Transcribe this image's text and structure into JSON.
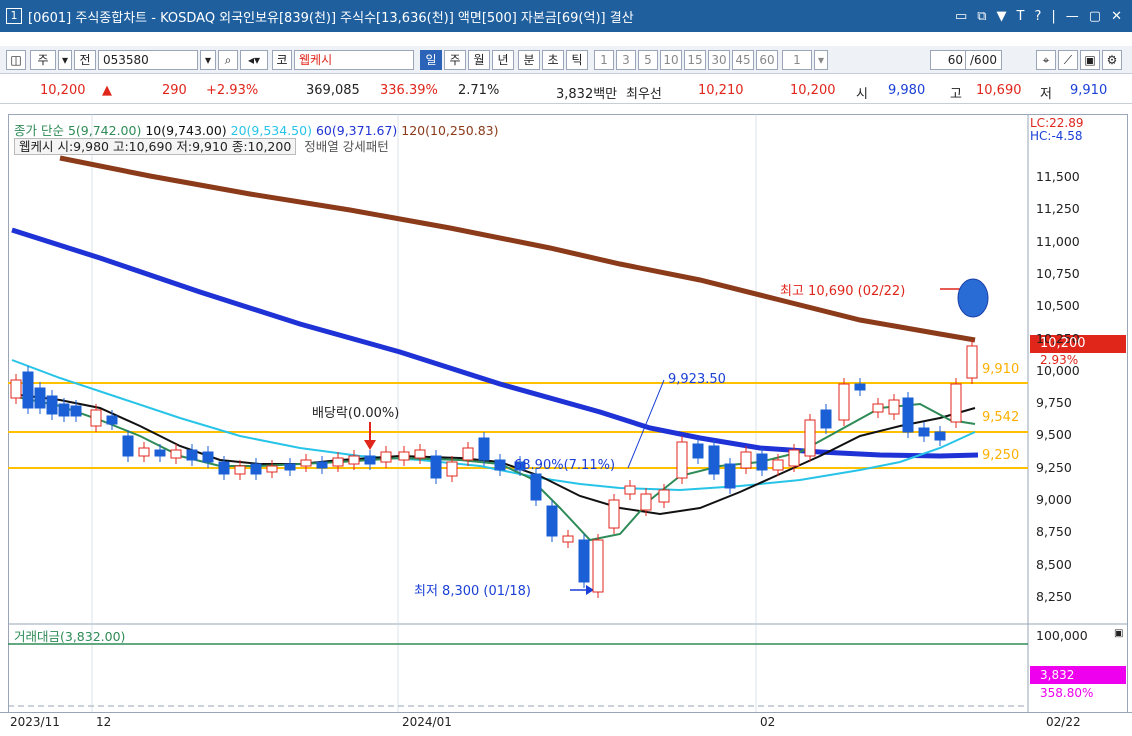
{
  "titlebar": {
    "num": "1",
    "title": "[0601] 주식종합차트 - KOSDAQ 외국인보유[839(천)] 주식수[13,636(천)] 액면[500] 자본금[69(억)] 결산",
    "buttons": [
      "▭",
      "⧉",
      "▼",
      "T",
      "?",
      "|",
      "—",
      "▢",
      "✕"
    ]
  },
  "toolbar": {
    "type_select": "주",
    "range_select": "전",
    "code": "053580",
    "market": "코",
    "name": "웹케시",
    "periods": [
      "일",
      "주",
      "월",
      "년",
      "분",
      "초",
      "틱"
    ],
    "intervals": [
      "1",
      "3",
      "5",
      "10",
      "15",
      "30",
      "45",
      "60",
      "1"
    ],
    "count": "60",
    "total": "/600"
  },
  "quote": {
    "price": "10,200",
    "change": "290",
    "change_pct": "+2.93%",
    "volume": "369,085",
    "vol_ratio": "336.39%",
    "turnover": "2.71%",
    "amount": "3,832백만",
    "best_label": "최우선",
    "ask": "10,210",
    "bid": "10,200",
    "open_label": "시",
    "open": "9,980",
    "high_label": "고",
    "high": "10,690",
    "low_label": "저",
    "low": "9,910"
  },
  "legend": {
    "close": "종가 단순",
    "ma5": "5(9,742.00)",
    "ma10": "10(9,743.00)",
    "ma20": "20(9,534.50)",
    "ma60": "60(9,371.67)",
    "ma120": "120(10,250.83)",
    "stock_info": "웹케시 시:9,980 고:10,690 저:9,910 종:10,200",
    "pattern": "정배열 강세패턴",
    "lc": "LC:22.89",
    "hc": "HC:-4.58"
  },
  "annotations": {
    "high_note": "최고 10,690 (02/22)",
    "low_note": "최저 8,300 (01/18)",
    "dividend": "배당락(0.00%)",
    "line_value": "9,923.50",
    "line_pct": "68.90%(7.11%)",
    "level_9910": "9,910",
    "level_9542": "9,542",
    "level_9250": "9,250",
    "current": "10,200",
    "current_pct": "2.93%"
  },
  "price_axis": [
    "11,500",
    "11,250",
    "11,000",
    "10,750",
    "10,500",
    "10,250",
    "10,000",
    "9,750",
    "9,500",
    "9,250",
    "9,000",
    "8,750",
    "8,500",
    "8,250"
  ],
  "volume": {
    "legend": "거래대금(3,832.00)",
    "axis_top": "100,000",
    "current": "3,832",
    "ratio": "358.80%"
  },
  "x_axis": [
    "2023/11",
    "12",
    "2024/01",
    "02",
    "02/22"
  ],
  "colors": {
    "title_bg": "#1f5f9e",
    "ma5": "#2e8b57",
    "ma10": "#111111",
    "ma20": "#27c4e8",
    "ma60": "#1f32d6",
    "ma120": "#8b3a1a",
    "up": "#e0251b",
    "down": "#1a5fd6",
    "level": "#ffc000"
  }
}
